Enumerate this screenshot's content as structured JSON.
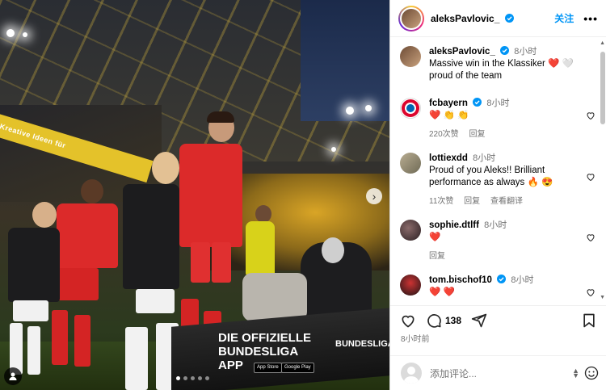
{
  "photo": {
    "band_text": "Kreative Ideen für",
    "ad_main_line1": "DIE OFFIZIELLE",
    "ad_main_line2": "BUNDESLIGA",
    "ad_main_line3": "APP",
    "ad_right": "BUNDESLIGA",
    "app_store": "App Store",
    "google_play": "Google Play",
    "next_arrow": "›",
    "carousel_dots": 5,
    "active_dot": 1
  },
  "header": {
    "username": "aleksPavlovic_",
    "follow_label": "关注",
    "more_label": "•••"
  },
  "caption": {
    "username": "aleksPavlovic_",
    "time": "8小时",
    "text_line1": "Massive win in the Klassiker ❤️ 🤍",
    "text_line2": "proud of the team"
  },
  "comments": [
    {
      "username": "fcbayern",
      "verified": true,
      "time": "8小时",
      "text": "❤️ 👏 👏",
      "likes": "220次赞",
      "reply": "回复",
      "translate": ""
    },
    {
      "username": "lottiexdd",
      "verified": false,
      "time": "8小时",
      "text": "Proud of you Aleks!! Brilliant performance as always 🔥 😍",
      "likes": "11次赞",
      "reply": "回复",
      "translate": "查看翻译"
    },
    {
      "username": "sophie.dtlff",
      "verified": false,
      "time": "8小时",
      "text": "❤️",
      "likes": "",
      "reply": "回复",
      "translate": ""
    },
    {
      "username": "tom.bischof10",
      "verified": true,
      "time": "8小时",
      "text": "❤️ ❤️",
      "likes": "",
      "reply": "",
      "translate": ""
    }
  ],
  "actions": {
    "like_count": "138",
    "post_time": "8小时前"
  },
  "add_comment": {
    "placeholder": "添加评论..."
  },
  "colors": {
    "accent": "#0095f6",
    "muted": "#737373",
    "heart": "#ed4956"
  }
}
